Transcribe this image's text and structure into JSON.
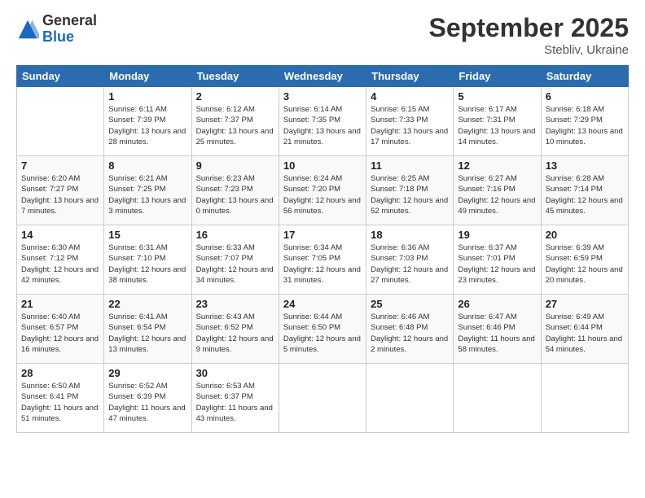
{
  "header": {
    "logo_general": "General",
    "logo_blue": "Blue",
    "month_title": "September 2025",
    "subtitle": "Stebliv, Ukraine"
  },
  "days_of_week": [
    "Sunday",
    "Monday",
    "Tuesday",
    "Wednesday",
    "Thursday",
    "Friday",
    "Saturday"
  ],
  "weeks": [
    [
      {
        "day": "",
        "info": ""
      },
      {
        "day": "1",
        "info": "Sunrise: 6:11 AM\nSunset: 7:39 PM\nDaylight: 13 hours and 28 minutes."
      },
      {
        "day": "2",
        "info": "Sunrise: 6:12 AM\nSunset: 7:37 PM\nDaylight: 13 hours and 25 minutes."
      },
      {
        "day": "3",
        "info": "Sunrise: 6:14 AM\nSunset: 7:35 PM\nDaylight: 13 hours and 21 minutes."
      },
      {
        "day": "4",
        "info": "Sunrise: 6:15 AM\nSunset: 7:33 PM\nDaylight: 13 hours and 17 minutes."
      },
      {
        "day": "5",
        "info": "Sunrise: 6:17 AM\nSunset: 7:31 PM\nDaylight: 13 hours and 14 minutes."
      },
      {
        "day": "6",
        "info": "Sunrise: 6:18 AM\nSunset: 7:29 PM\nDaylight: 13 hours and 10 minutes."
      }
    ],
    [
      {
        "day": "7",
        "info": "Sunrise: 6:20 AM\nSunset: 7:27 PM\nDaylight: 13 hours and 7 minutes."
      },
      {
        "day": "8",
        "info": "Sunrise: 6:21 AM\nSunset: 7:25 PM\nDaylight: 13 hours and 3 minutes."
      },
      {
        "day": "9",
        "info": "Sunrise: 6:23 AM\nSunset: 7:23 PM\nDaylight: 13 hours and 0 minutes."
      },
      {
        "day": "10",
        "info": "Sunrise: 6:24 AM\nSunset: 7:20 PM\nDaylight: 12 hours and 56 minutes."
      },
      {
        "day": "11",
        "info": "Sunrise: 6:25 AM\nSunset: 7:18 PM\nDaylight: 12 hours and 52 minutes."
      },
      {
        "day": "12",
        "info": "Sunrise: 6:27 AM\nSunset: 7:16 PM\nDaylight: 12 hours and 49 minutes."
      },
      {
        "day": "13",
        "info": "Sunrise: 6:28 AM\nSunset: 7:14 PM\nDaylight: 12 hours and 45 minutes."
      }
    ],
    [
      {
        "day": "14",
        "info": "Sunrise: 6:30 AM\nSunset: 7:12 PM\nDaylight: 12 hours and 42 minutes."
      },
      {
        "day": "15",
        "info": "Sunrise: 6:31 AM\nSunset: 7:10 PM\nDaylight: 12 hours and 38 minutes."
      },
      {
        "day": "16",
        "info": "Sunrise: 6:33 AM\nSunset: 7:07 PM\nDaylight: 12 hours and 34 minutes."
      },
      {
        "day": "17",
        "info": "Sunrise: 6:34 AM\nSunset: 7:05 PM\nDaylight: 12 hours and 31 minutes."
      },
      {
        "day": "18",
        "info": "Sunrise: 6:36 AM\nSunset: 7:03 PM\nDaylight: 12 hours and 27 minutes."
      },
      {
        "day": "19",
        "info": "Sunrise: 6:37 AM\nSunset: 7:01 PM\nDaylight: 12 hours and 23 minutes."
      },
      {
        "day": "20",
        "info": "Sunrise: 6:39 AM\nSunset: 6:59 PM\nDaylight: 12 hours and 20 minutes."
      }
    ],
    [
      {
        "day": "21",
        "info": "Sunrise: 6:40 AM\nSunset: 6:57 PM\nDaylight: 12 hours and 16 minutes."
      },
      {
        "day": "22",
        "info": "Sunrise: 6:41 AM\nSunset: 6:54 PM\nDaylight: 12 hours and 13 minutes."
      },
      {
        "day": "23",
        "info": "Sunrise: 6:43 AM\nSunset: 6:52 PM\nDaylight: 12 hours and 9 minutes."
      },
      {
        "day": "24",
        "info": "Sunrise: 6:44 AM\nSunset: 6:50 PM\nDaylight: 12 hours and 5 minutes."
      },
      {
        "day": "25",
        "info": "Sunrise: 6:46 AM\nSunset: 6:48 PM\nDaylight: 12 hours and 2 minutes."
      },
      {
        "day": "26",
        "info": "Sunrise: 6:47 AM\nSunset: 6:46 PM\nDaylight: 11 hours and 58 minutes."
      },
      {
        "day": "27",
        "info": "Sunrise: 6:49 AM\nSunset: 6:44 PM\nDaylight: 11 hours and 54 minutes."
      }
    ],
    [
      {
        "day": "28",
        "info": "Sunrise: 6:50 AM\nSunset: 6:41 PM\nDaylight: 11 hours and 51 minutes."
      },
      {
        "day": "29",
        "info": "Sunrise: 6:52 AM\nSunset: 6:39 PM\nDaylight: 11 hours and 47 minutes."
      },
      {
        "day": "30",
        "info": "Sunrise: 6:53 AM\nSunset: 6:37 PM\nDaylight: 11 hours and 43 minutes."
      },
      {
        "day": "",
        "info": ""
      },
      {
        "day": "",
        "info": ""
      },
      {
        "day": "",
        "info": ""
      },
      {
        "day": "",
        "info": ""
      }
    ]
  ]
}
